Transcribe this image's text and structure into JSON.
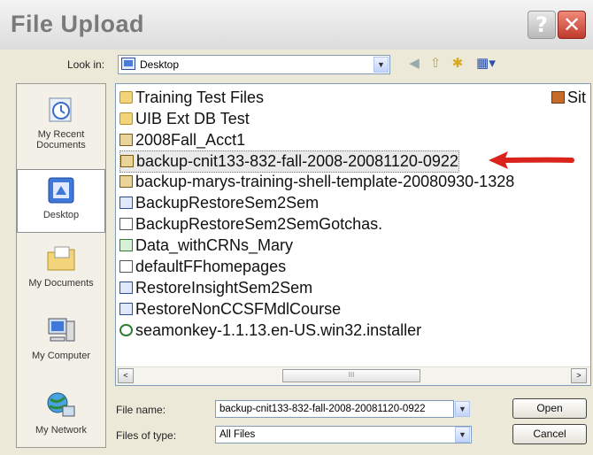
{
  "window": {
    "title": "File Upload",
    "help_glyph": "?",
    "close_glyph": "✕"
  },
  "lookin": {
    "label": "Look in:",
    "value": "Desktop",
    "dropdown_icon": "chevron-down-icon"
  },
  "toolbar": {
    "back_icon": "back-icon",
    "up_icon": "up-folder-icon",
    "newfolder_icon": "new-folder-icon",
    "views_icon": "views-menu-icon"
  },
  "places": [
    {
      "label": "My Recent Documents",
      "icon": "recent-documents-icon"
    },
    {
      "label": "Desktop",
      "icon": "desktop-icon",
      "selected": true
    },
    {
      "label": "My Documents",
      "icon": "my-documents-icon"
    },
    {
      "label": "My Computer",
      "icon": "my-computer-icon"
    },
    {
      "label": "My Network",
      "icon": "my-network-icon"
    }
  ],
  "files": [
    {
      "name": "Training Test Files",
      "type": "folder"
    },
    {
      "name": "UIB Ext DB Test",
      "type": "folder"
    },
    {
      "name": "2008Fall_Acct1",
      "type": "zip"
    },
    {
      "name": "backup-cnit133-832-fall-2008-20081120-0922",
      "type": "zip",
      "selected": true
    },
    {
      "name": "backup-marys-training-shell-template-20080930-1328",
      "type": "zip"
    },
    {
      "name": "BackupRestoreSem2Sem",
      "type": "word"
    },
    {
      "name": "BackupRestoreSem2SemGotchas.",
      "type": "doc"
    },
    {
      "name": "Data_withCRNs_Mary",
      "type": "xls"
    },
    {
      "name": "defaultFFhomepages",
      "type": "doc"
    },
    {
      "name": "RestoreInsightSem2Sem",
      "type": "word"
    },
    {
      "name": "RestoreNonCCSFMdlCourse",
      "type": "word"
    },
    {
      "name": "seamonkey-1.1.13.en-US.win32.installer",
      "type": "installer"
    }
  ],
  "files_col2": {
    "name": "Sit",
    "type": "image"
  },
  "scrollbar": {
    "left": "<",
    "right": ">",
    "thumb_grip": "III"
  },
  "filename": {
    "label": "File name:",
    "value": "backup-cnit133-832-fall-2008-20081120-0922"
  },
  "filetype": {
    "label": "Files of type:",
    "value": "All Files"
  },
  "buttons": {
    "open": "Open",
    "cancel": "Cancel"
  },
  "colors": {
    "annotation_arrow": "#d9241c",
    "selection": "#eaeaea"
  }
}
